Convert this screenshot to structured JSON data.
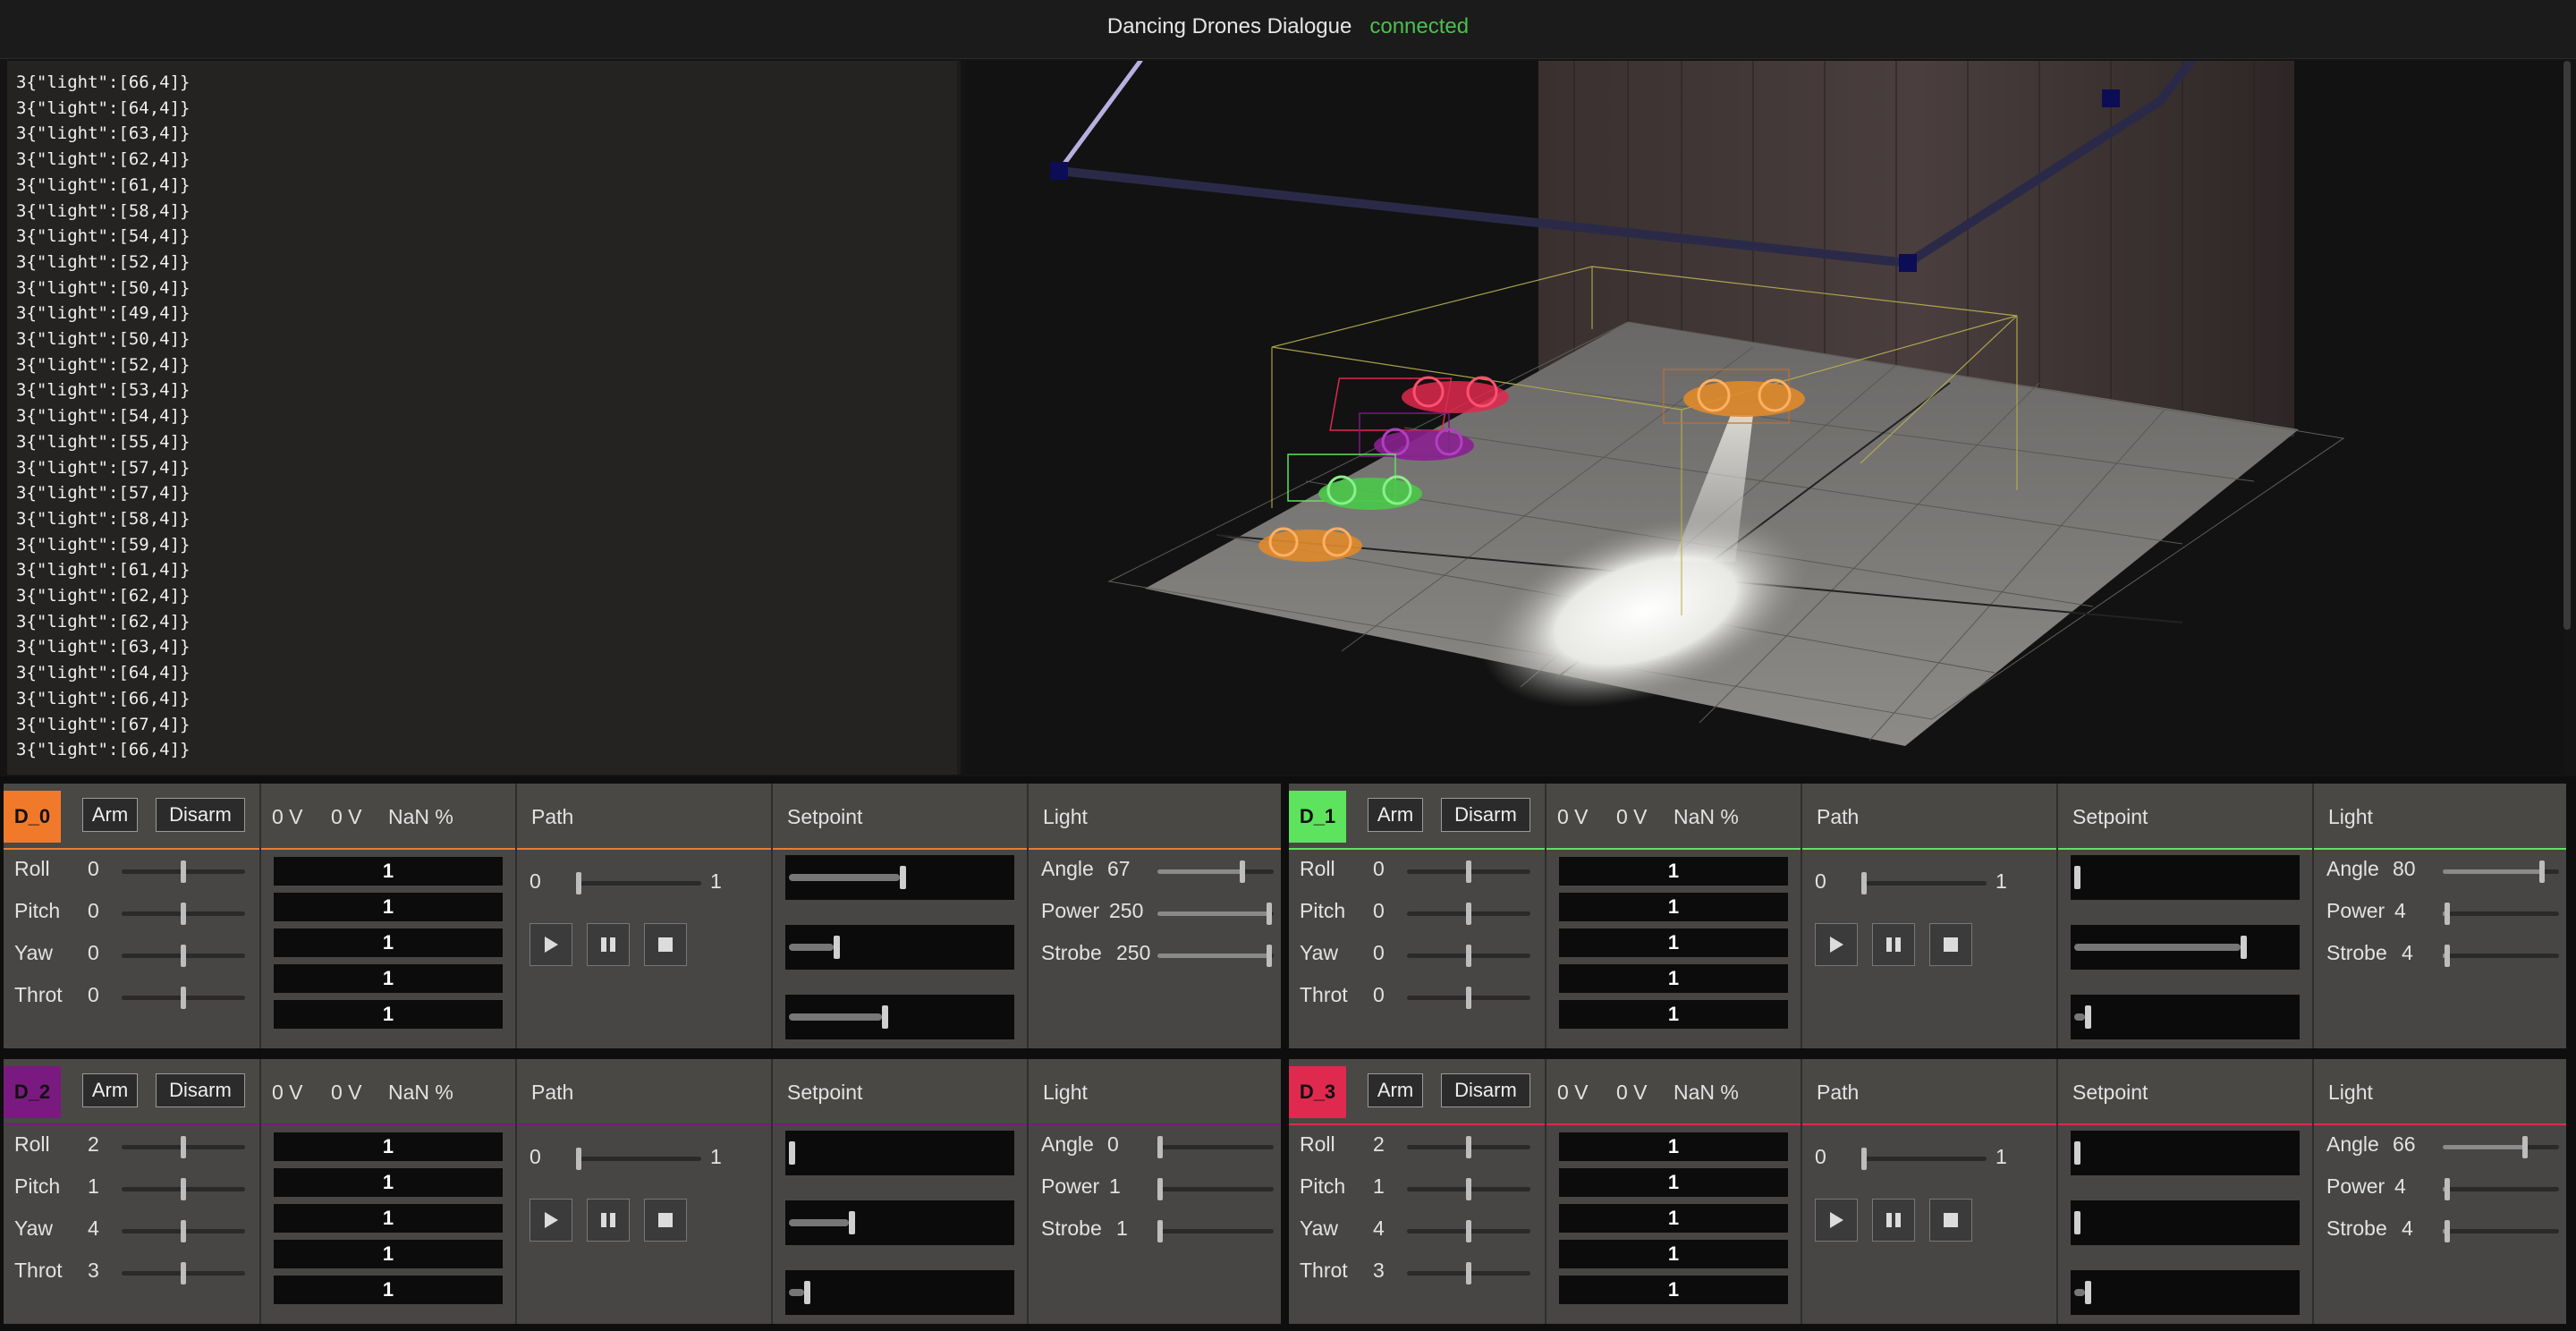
{
  "app": {
    "title": "Dancing Drones Dialogue",
    "status": "connected"
  },
  "log": [
    "3{\"light\":[66,4]}",
    "3{\"light\":[64,4]}",
    "3{\"light\":[63,4]}",
    "3{\"light\":[62,4]}",
    "3{\"light\":[61,4]}",
    "3{\"light\":[58,4]}",
    "3{\"light\":[54,4]}",
    "3{\"light\":[52,4]}",
    "3{\"light\":[50,4]}",
    "3{\"light\":[49,4]}",
    "3{\"light\":[50,4]}",
    "3{\"light\":[52,4]}",
    "3{\"light\":[53,4]}",
    "3{\"light\":[54,4]}",
    "3{\"light\":[55,4]}",
    "3{\"light\":[57,4]}",
    "3{\"light\":[57,4]}",
    "3{\"light\":[58,4]}",
    "3{\"light\":[59,4]}",
    "3{\"light\":[61,4]}",
    "3{\"light\":[62,4]}",
    "3{\"light\":[62,4]}",
    "3{\"light\":[63,4]}",
    "3{\"light\":[64,4]}",
    "3{\"light\":[66,4]}",
    "3{\"light\":[67,4]}",
    "3{\"light\":[66,4]}"
  ],
  "labels": {
    "arm": "Arm",
    "disarm": "Disarm",
    "v1": "0 V",
    "v2": "0 V",
    "pct": "NaN %",
    "path": "Path",
    "setpoint": "Setpoint",
    "light": "Light",
    "roll": "Roll",
    "pitch": "Pitch",
    "yaw": "Yaw",
    "throt": "Throt",
    "angle": "Angle",
    "power": "Power",
    "strobe": "Strobe",
    "path_min": "0",
    "path_max": "1"
  },
  "drones": [
    {
      "name": "D_0",
      "color": "#f07a2a",
      "roll": "0",
      "pitch": "0",
      "yaw": "0",
      "throt": "0",
      "ctrl_levels": [
        0.5,
        0.5,
        0.5,
        0.5
      ],
      "bars": [
        "1",
        "1",
        "1",
        "1",
        "1"
      ],
      "path_level": 0,
      "setpoint_levels": [
        0.5,
        0.2,
        0.42
      ],
      "angle": "67",
      "power": "250",
      "strobe": "250",
      "light_levels": [
        0.74,
        0.98,
        0.98
      ]
    },
    {
      "name": "D_1",
      "color": "#5ee35e",
      "roll": "0",
      "pitch": "0",
      "yaw": "0",
      "throt": "0",
      "ctrl_levels": [
        0.5,
        0.5,
        0.5,
        0.5
      ],
      "bars": [
        "1",
        "1",
        "1",
        "1",
        "1"
      ],
      "path_level": 0,
      "setpoint_levels": [
        0.0,
        0.75,
        0.05
      ],
      "angle": "80",
      "power": "4",
      "strobe": "4",
      "light_levels": [
        0.87,
        0.02,
        0.02
      ]
    },
    {
      "name": "D_2",
      "color": "#7a1a80",
      "roll": "2",
      "pitch": "1",
      "yaw": "4",
      "throt": "3",
      "ctrl_levels": [
        0.5,
        0.5,
        0.5,
        0.5
      ],
      "bars": [
        "1",
        "1",
        "1",
        "1",
        "1"
      ],
      "path_level": 0,
      "setpoint_levels": [
        0.0,
        0.27,
        0.07
      ],
      "angle": "0",
      "power": "1",
      "strobe": "1",
      "light_levels": [
        0.0,
        0.0,
        0.0
      ]
    },
    {
      "name": "D_3",
      "color": "#e0294e",
      "roll": "2",
      "pitch": "1",
      "yaw": "4",
      "throt": "3",
      "ctrl_levels": [
        0.5,
        0.5,
        0.5,
        0.5
      ],
      "bars": [
        "1",
        "1",
        "1",
        "1",
        "1"
      ],
      "path_level": 0,
      "setpoint_levels": [
        0.0,
        0.0,
        0.05
      ],
      "angle": "66",
      "power": "4",
      "strobe": "4",
      "light_levels": [
        0.72,
        0.02,
        0.02
      ]
    }
  ]
}
